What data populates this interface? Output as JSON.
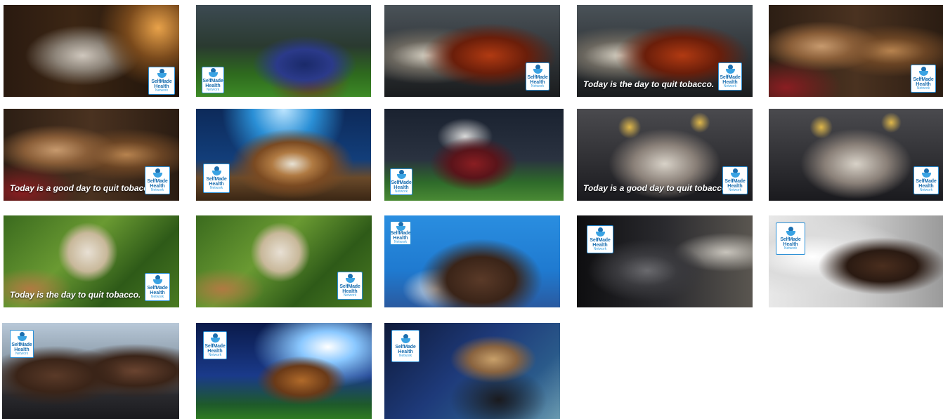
{
  "logo": {
    "line1": "SelfMade",
    "line2": "Health",
    "line3": "Network"
  },
  "tiles": [
    {
      "subject": "Older man smiling in dim living room",
      "caption": ""
    },
    {
      "subject": "Football player gloves on ball",
      "caption": ""
    },
    {
      "subject": "Football player with fire effect",
      "caption": ""
    },
    {
      "subject": "Football player with fire effect",
      "caption": "Today is the day to quit tobacco."
    },
    {
      "subject": "Fans watching anxiously",
      "caption": ""
    },
    {
      "subject": "Fans watching anxiously",
      "caption": "Today is a good day to quit tobacco."
    },
    {
      "subject": "Baseball in glove in stadium",
      "caption": ""
    },
    {
      "subject": "Baseball pitcher",
      "caption": ""
    },
    {
      "subject": "Friends celebrating at home with confetti",
      "caption": "Today is a good day to quit tobacco."
    },
    {
      "subject": "Friends celebrating at home with confetti",
      "caption": ""
    },
    {
      "subject": "Baseball among corn husks",
      "caption": "Today is the day to quit tobacco."
    },
    {
      "subject": "Baseball among corn husks",
      "caption": ""
    },
    {
      "subject": "Family cheering on blue background",
      "caption": ""
    },
    {
      "subject": "Man in baseball jersey watching game",
      "caption": ""
    },
    {
      "subject": "Man in beanie looking at phone by window",
      "caption": ""
    },
    {
      "subject": "Group of friends smiling",
      "caption": ""
    },
    {
      "subject": "Football on tee in lit stadium",
      "caption": ""
    },
    {
      "subject": "Boot stepping on truck step",
      "caption": ""
    }
  ]
}
